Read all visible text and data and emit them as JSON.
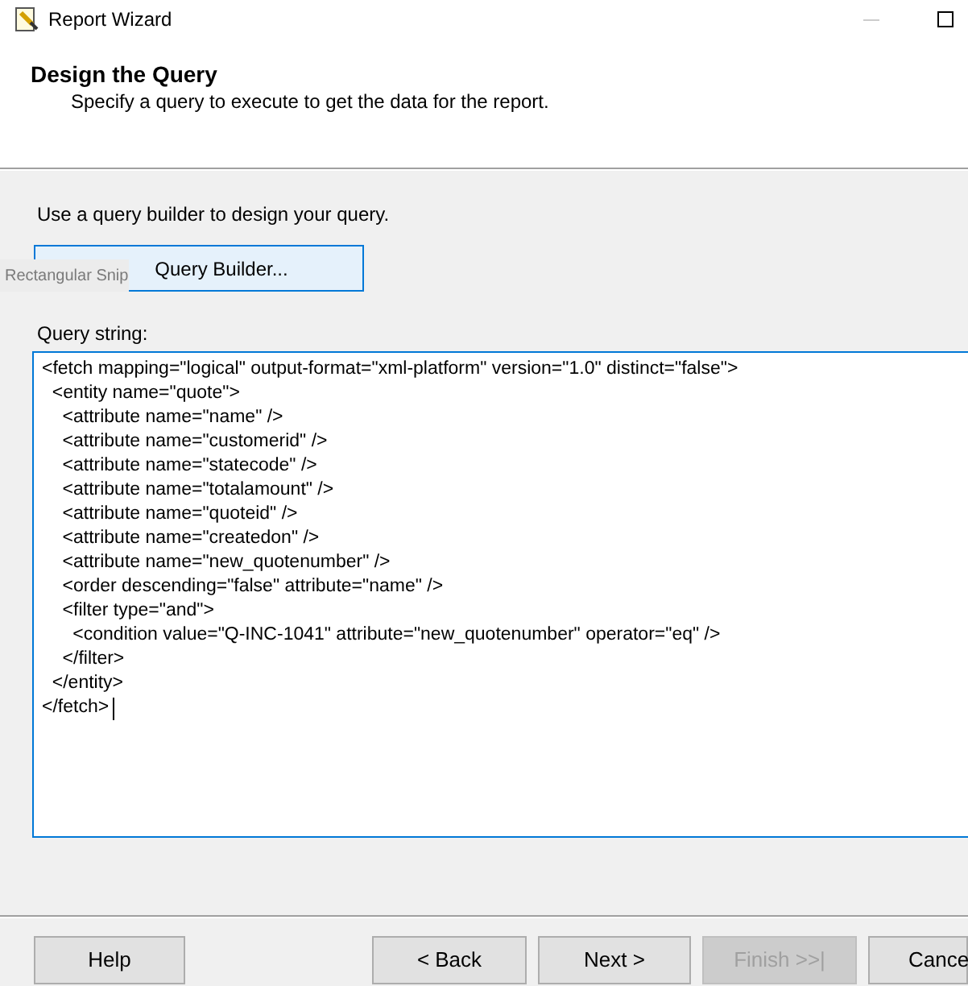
{
  "window": {
    "title": "Report Wizard"
  },
  "header": {
    "title": "Design the Query",
    "subtitle": "Specify a query to execute to get the data for the report."
  },
  "instruction": "Use a query builder to design your query.",
  "query_builder_button": "Query Builder...",
  "tooltip": "Rectangular Snip",
  "query_string": {
    "label": "Query string:",
    "lines": [
      "<fetch mapping=\"logical\" output-format=\"xml-platform\" version=\"1.0\" distinct=\"false\">",
      "  <entity name=\"quote\">",
      "    <attribute name=\"name\" />",
      "    <attribute name=\"customerid\" />",
      "    <attribute name=\"statecode\" />",
      "    <attribute name=\"totalamount\" />",
      "    <attribute name=\"quoteid\" />",
      "    <attribute name=\"createdon\" />",
      "    <attribute name=\"new_quotenumber\" />",
      "    <order descending=\"false\" attribute=\"name\" />",
      "    <filter type=\"and\">",
      "      <condition value=\"Q-INC-1041\" attribute=\"new_quotenumber\" operator=\"eq\" />",
      "    </filter>",
      "  </entity>",
      "</fetch>"
    ]
  },
  "buttons": [
    {
      "label": "Help",
      "disabled": false
    },
    {
      "label": "< Back",
      "disabled": false
    },
    {
      "label": "Next >",
      "disabled": false
    },
    {
      "label": "Finish >>|",
      "disabled": true
    },
    {
      "label": "Cance",
      "disabled": false
    }
  ]
}
